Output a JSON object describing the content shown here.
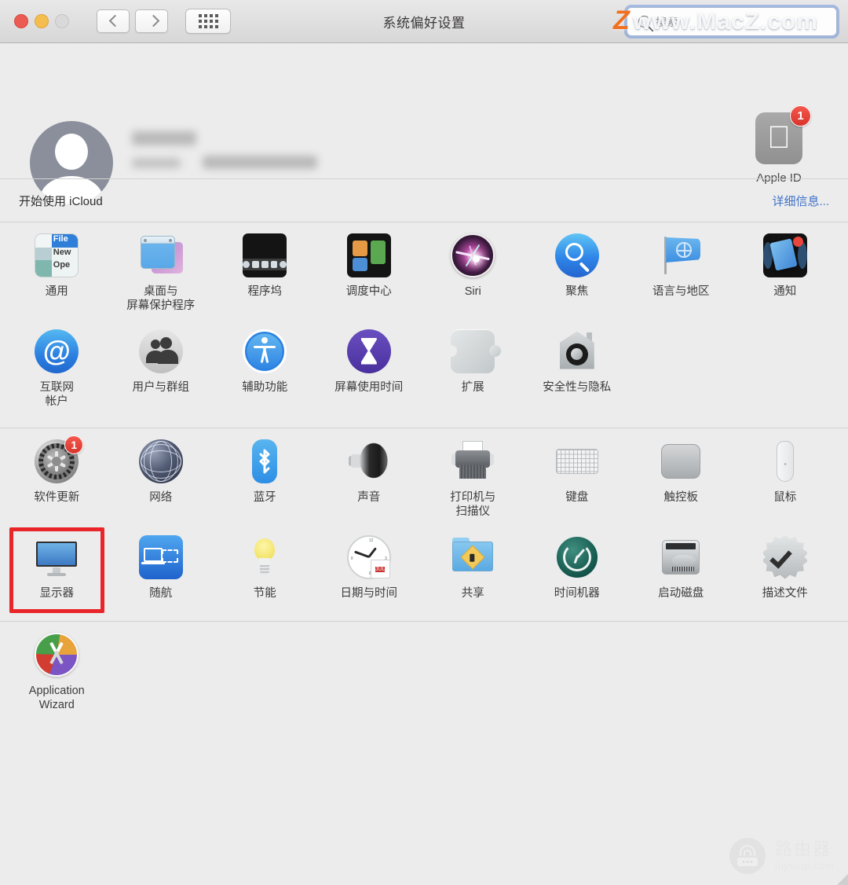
{
  "window": {
    "title": "系统偏好设置",
    "traffic_lights": [
      "close",
      "minimize",
      "zoom"
    ],
    "nav_back": "‹",
    "nav_forward": "›",
    "grid_button": "show-all-grid"
  },
  "search": {
    "placeholder": "搜索",
    "value": "",
    "icon": "search-icon"
  },
  "watermark_top": {
    "logo": "Z",
    "text": "www.MacZ.com"
  },
  "watermark_bottom": {
    "title": "路由器",
    "subtitle": "luyouqi.com",
    "icon": "router-icon"
  },
  "account": {
    "avatar": "user-avatar",
    "name_redacted": true,
    "email_redacted": true,
    "apple_id_label": "Apple ID",
    "apple_id_badge": "1",
    "apple_id_icon": "apple-logo-icon"
  },
  "icloud": {
    "text": "开始使用 iCloud",
    "link": "详细信息..."
  },
  "colors": {
    "window_bg": "#ececec",
    "titlebar_top": "#e9e8e8",
    "titlebar_bottom": "#d8d7d7",
    "link_blue": "#3f72c9",
    "badge_red": "#d8342b",
    "highlight_red": "#e8262a",
    "focus_ring": "#6c96de",
    "label_text": "#3d3c3c"
  },
  "groups": [
    {
      "id": "personal",
      "items": [
        {
          "label": "通用",
          "icon": "general-icon",
          "highlighted": false
        },
        {
          "label": "桌面与\n屏幕保护程序",
          "icon": "desktop-screensaver-icon",
          "highlighted": false
        },
        {
          "label": "程序坞",
          "icon": "dock-icon",
          "highlighted": false
        },
        {
          "label": "调度中心",
          "icon": "mission-control-icon",
          "highlighted": false
        },
        {
          "label": "Siri",
          "icon": "siri-icon",
          "highlighted": false
        },
        {
          "label": "聚焦",
          "icon": "spotlight-icon",
          "highlighted": false
        },
        {
          "label": "语言与地区",
          "icon": "language-region-icon",
          "highlighted": false
        },
        {
          "label": "通知",
          "icon": "notifications-icon",
          "highlighted": false
        },
        {
          "label": "互联网\n帐户",
          "icon": "internet-accounts-icon",
          "highlighted": false
        },
        {
          "label": "用户与群组",
          "icon": "users-groups-icon",
          "highlighted": false
        },
        {
          "label": "辅助功能",
          "icon": "accessibility-icon",
          "highlighted": false
        },
        {
          "label": "屏幕使用时间",
          "icon": "screen-time-icon",
          "highlighted": false
        },
        {
          "label": "扩展",
          "icon": "extensions-icon",
          "highlighted": false
        },
        {
          "label": "安全性与隐私",
          "icon": "security-privacy-icon",
          "highlighted": false
        }
      ]
    },
    {
      "id": "hardware",
      "items": [
        {
          "label": "软件更新",
          "icon": "software-update-icon",
          "badge": "1",
          "highlighted": false
        },
        {
          "label": "网络",
          "icon": "network-icon",
          "highlighted": false
        },
        {
          "label": "蓝牙",
          "icon": "bluetooth-icon",
          "highlighted": false
        },
        {
          "label": "声音",
          "icon": "sound-icon",
          "highlighted": false
        },
        {
          "label": "打印机与\n扫描仪",
          "icon": "printers-scanners-icon",
          "highlighted": false
        },
        {
          "label": "键盘",
          "icon": "keyboard-icon",
          "highlighted": false
        },
        {
          "label": "触控板",
          "icon": "trackpad-icon",
          "highlighted": false
        },
        {
          "label": "鼠标",
          "icon": "mouse-icon",
          "highlighted": false
        },
        {
          "label": "显示器",
          "icon": "displays-icon",
          "highlighted": true
        },
        {
          "label": "随航",
          "icon": "sidecar-icon",
          "highlighted": false
        },
        {
          "label": "节能",
          "icon": "energy-saver-icon",
          "highlighted": false
        },
        {
          "label": "日期与时间",
          "icon": "date-time-icon",
          "highlighted": false
        },
        {
          "label": "共享",
          "icon": "sharing-icon",
          "highlighted": false
        },
        {
          "label": "时间机器",
          "icon": "time-machine-icon",
          "highlighted": false
        },
        {
          "label": "启动磁盘",
          "icon": "startup-disk-icon",
          "highlighted": false
        },
        {
          "label": "描述文件",
          "icon": "profiles-icon",
          "highlighted": false
        }
      ]
    },
    {
      "id": "other",
      "items": [
        {
          "label": "Application\nWizard",
          "icon": "application-wizard-icon",
          "highlighted": false
        }
      ]
    }
  ],
  "date_time_icon": {
    "month": "JUL",
    "day": "18"
  },
  "general_icon_text": {
    "file": "File",
    "new": "New",
    "open": "Ope"
  }
}
